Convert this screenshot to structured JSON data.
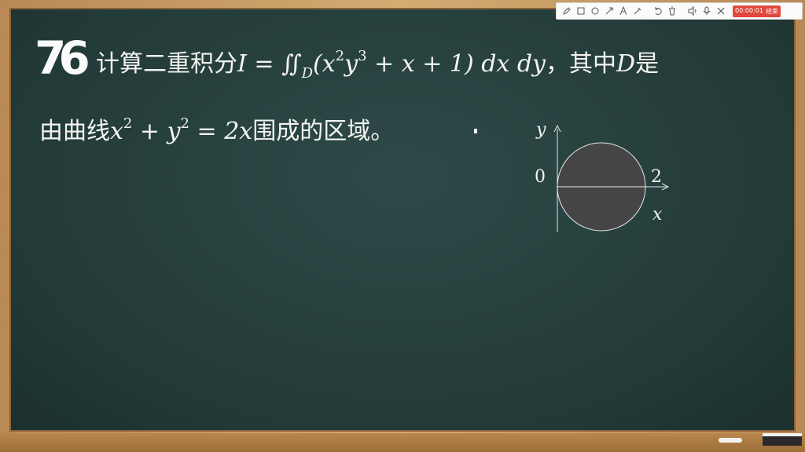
{
  "problem": {
    "number": "76",
    "line1_prefix": "计算二重积分",
    "line1_formula": "I = ∬",
    "line1_domain": "D",
    "line1_integrand": "(x",
    "line1_exp_a": "2",
    "line1_y": "y",
    "line1_exp_b": "3",
    "line1_rest": " + x + 1) dx dy",
    "line1_suffix": "，其中",
    "line1_region": "D",
    "line1_end": "是",
    "line2_prefix": "由曲线",
    "line2_x": "x",
    "line2_exp_a": "2",
    "line2_plus": " + y",
    "line2_exp_b": "2",
    "line2_eq": " = 2x",
    "line2_suffix": "围成的区域。"
  },
  "diagram": {
    "y_label": "y",
    "x_label": "x",
    "origin_label": "0",
    "right_label": "2",
    "circle_fill": "#454545",
    "circle_stroke": "#e8e8e8"
  },
  "toolbar": {
    "tools": [
      "pen-icon",
      "rectangle-icon",
      "circle-icon",
      "arrow-icon",
      "text-icon",
      "highlighter-icon",
      "undo-icon",
      "trash-icon",
      "volume-icon",
      "mic-icon",
      "close-icon"
    ],
    "timer": "00:00:01",
    "end_label": "结束"
  }
}
